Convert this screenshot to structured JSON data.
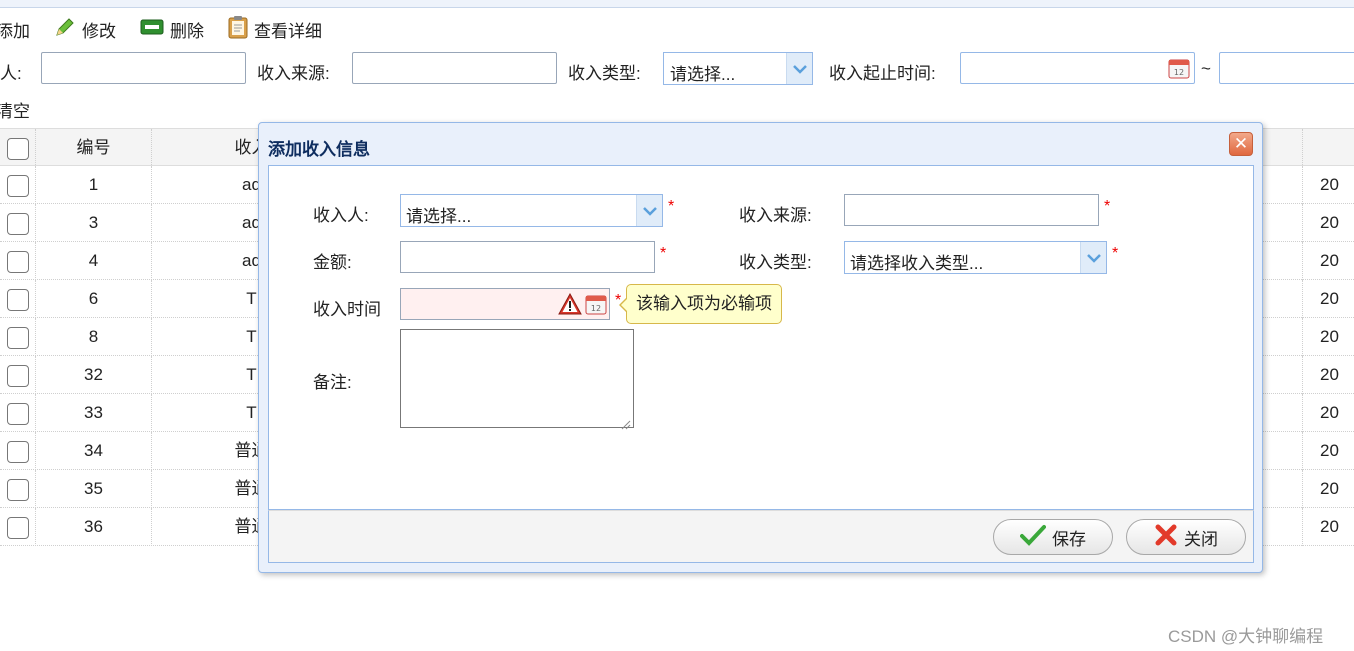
{
  "toolbar": {
    "add": "添加",
    "edit": "修改",
    "delete": "删除",
    "details": "查看详细"
  },
  "filter": {
    "person_label": "人:",
    "source_label": "收入来源:",
    "type_label": "收入类型:",
    "type_value": "请选择...",
    "range_label": "收入起止时间:",
    "range_sep": "~",
    "clear": "清空"
  },
  "grid": {
    "headers": {
      "id": "编号",
      "who": "收入"
    },
    "rows": [
      {
        "id": "1",
        "who": "ad",
        "date": "20"
      },
      {
        "id": "3",
        "who": "ad",
        "date": "20"
      },
      {
        "id": "4",
        "who": "ad",
        "date": "20"
      },
      {
        "id": "6",
        "who": "T",
        "date": "20"
      },
      {
        "id": "8",
        "who": "T",
        "date": "20"
      },
      {
        "id": "32",
        "who": "T",
        "date": "20"
      },
      {
        "id": "33",
        "who": "T",
        "date": "20"
      },
      {
        "id": "34",
        "who": "普通",
        "date": "20"
      },
      {
        "id": "35",
        "who": "普通",
        "date": "20"
      },
      {
        "id": "36",
        "who": "普通",
        "date": "20"
      }
    ]
  },
  "dialog": {
    "title": "添加收入信息",
    "person_label": "收入人:",
    "person_value": "请选择...",
    "source_label": "收入来源:",
    "amount_label": "金额:",
    "type_label": "收入类型:",
    "type_value": "请选择收入类型...",
    "time_label": "收入时间",
    "note_label": "备注:",
    "required_mark": "*",
    "tooltip": "该输入项为必输项",
    "save": "保存",
    "close": "关闭"
  },
  "watermark": "CSDN @大钟聊编程"
}
